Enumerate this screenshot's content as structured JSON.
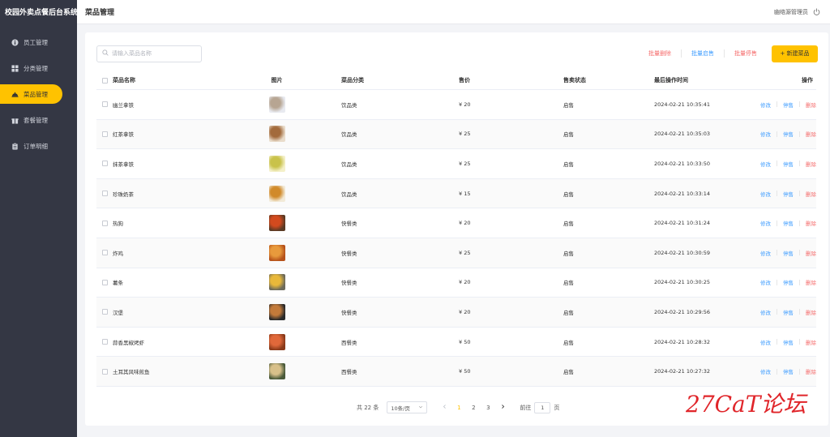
{
  "brand": "校园外卖点餐后台系统",
  "sidebar": {
    "items": [
      {
        "label": "员工管理",
        "icon": "user-info-icon",
        "active": false
      },
      {
        "label": "分类管理",
        "icon": "grid-icon",
        "active": false
      },
      {
        "label": "菜品管理",
        "icon": "dish-cover-icon",
        "active": true
      },
      {
        "label": "套餐管理",
        "icon": "gift-icon",
        "active": false
      },
      {
        "label": "订单明细",
        "icon": "clipboard-icon",
        "active": false
      }
    ]
  },
  "header": {
    "title": "菜品管理",
    "user": "幽络源管理员",
    "logout_icon": "power-icon"
  },
  "toolbar": {
    "search_placeholder": "请输入菜品名称",
    "batch_delete": "批量删除",
    "batch_enable": "批量启售",
    "batch_disable": "批量停售",
    "add_dish": "+ 新建菜品"
  },
  "table": {
    "headers": {
      "name": "菜品名称",
      "image": "图片",
      "category": "菜品分类",
      "price": "售价",
      "status": "售卖状态",
      "time": "最后操作时间",
      "ops": "操作"
    },
    "op_labels": {
      "edit": "修改",
      "disable": "停售",
      "delete": "删除"
    },
    "rows": [
      {
        "name": "幽兰拿铁",
        "category": "饮品类",
        "price": "¥ 20",
        "status": "启售",
        "time": "2024-02-21 10:35:41",
        "thumb": [
          "#e8eaf0",
          "#b7a592"
        ]
      },
      {
        "name": "红茶拿铁",
        "category": "饮品类",
        "price": "¥ 25",
        "status": "启售",
        "time": "2024-02-21 10:35:03",
        "thumb": [
          "#e9dccb",
          "#a36b3c"
        ]
      },
      {
        "name": "抹茶拿铁",
        "category": "饮品类",
        "price": "¥ 25",
        "status": "启售",
        "time": "2024-02-21 10:33:50",
        "thumb": [
          "#f4f0c9",
          "#c9c24a"
        ]
      },
      {
        "name": "珍珠奶茶",
        "category": "饮品类",
        "price": "¥ 15",
        "status": "启售",
        "time": "2024-02-21 10:33:14",
        "thumb": [
          "#f2ead8",
          "#d18a2a"
        ]
      },
      {
        "name": "热狗",
        "category": "快餐类",
        "price": "¥ 20",
        "status": "启售",
        "time": "2024-02-21 10:31:24",
        "thumb": [
          "#5a3a24",
          "#d24a1e"
        ]
      },
      {
        "name": "炸鸡",
        "category": "快餐类",
        "price": "¥ 25",
        "status": "启售",
        "time": "2024-02-21 10:30:59",
        "thumb": [
          "#b6521a",
          "#e89a3c"
        ]
      },
      {
        "name": "薯条",
        "category": "快餐类",
        "price": "¥ 20",
        "status": "启售",
        "time": "2024-02-21 10:30:25",
        "thumb": [
          "#6d6a5a",
          "#e8b83a"
        ]
      },
      {
        "name": "汉堡",
        "category": "快餐类",
        "price": "¥ 20",
        "status": "启售",
        "time": "2024-02-21 10:29:56",
        "thumb": [
          "#2a2a2a",
          "#c27a3a"
        ]
      },
      {
        "name": "蒜香黑椒烤虾",
        "category": "西餐类",
        "price": "¥ 50",
        "status": "启售",
        "time": "2024-02-21 10:28:32",
        "thumb": [
          "#8a3a1a",
          "#e0683a"
        ]
      },
      {
        "name": "土耳其风味煎鱼",
        "category": "西餐类",
        "price": "¥ 50",
        "status": "启售",
        "time": "2024-02-21 10:27:32",
        "thumb": [
          "#4a5a3a",
          "#d8c08a"
        ]
      }
    ]
  },
  "pagination": {
    "total": "共 22 条",
    "page_size": "10条/页",
    "pages": [
      "1",
      "2",
      "3"
    ],
    "current": "1",
    "goto_label": "前往",
    "goto_value": "1",
    "goto_suffix": "页"
  },
  "watermark": "27CaT论坛",
  "colors": {
    "accent": "#ffc200",
    "sidebar_bg": "#343744",
    "link_blue": "#419eff",
    "danger_red": "#f56c6c",
    "watermark_red": "#e0252a"
  }
}
